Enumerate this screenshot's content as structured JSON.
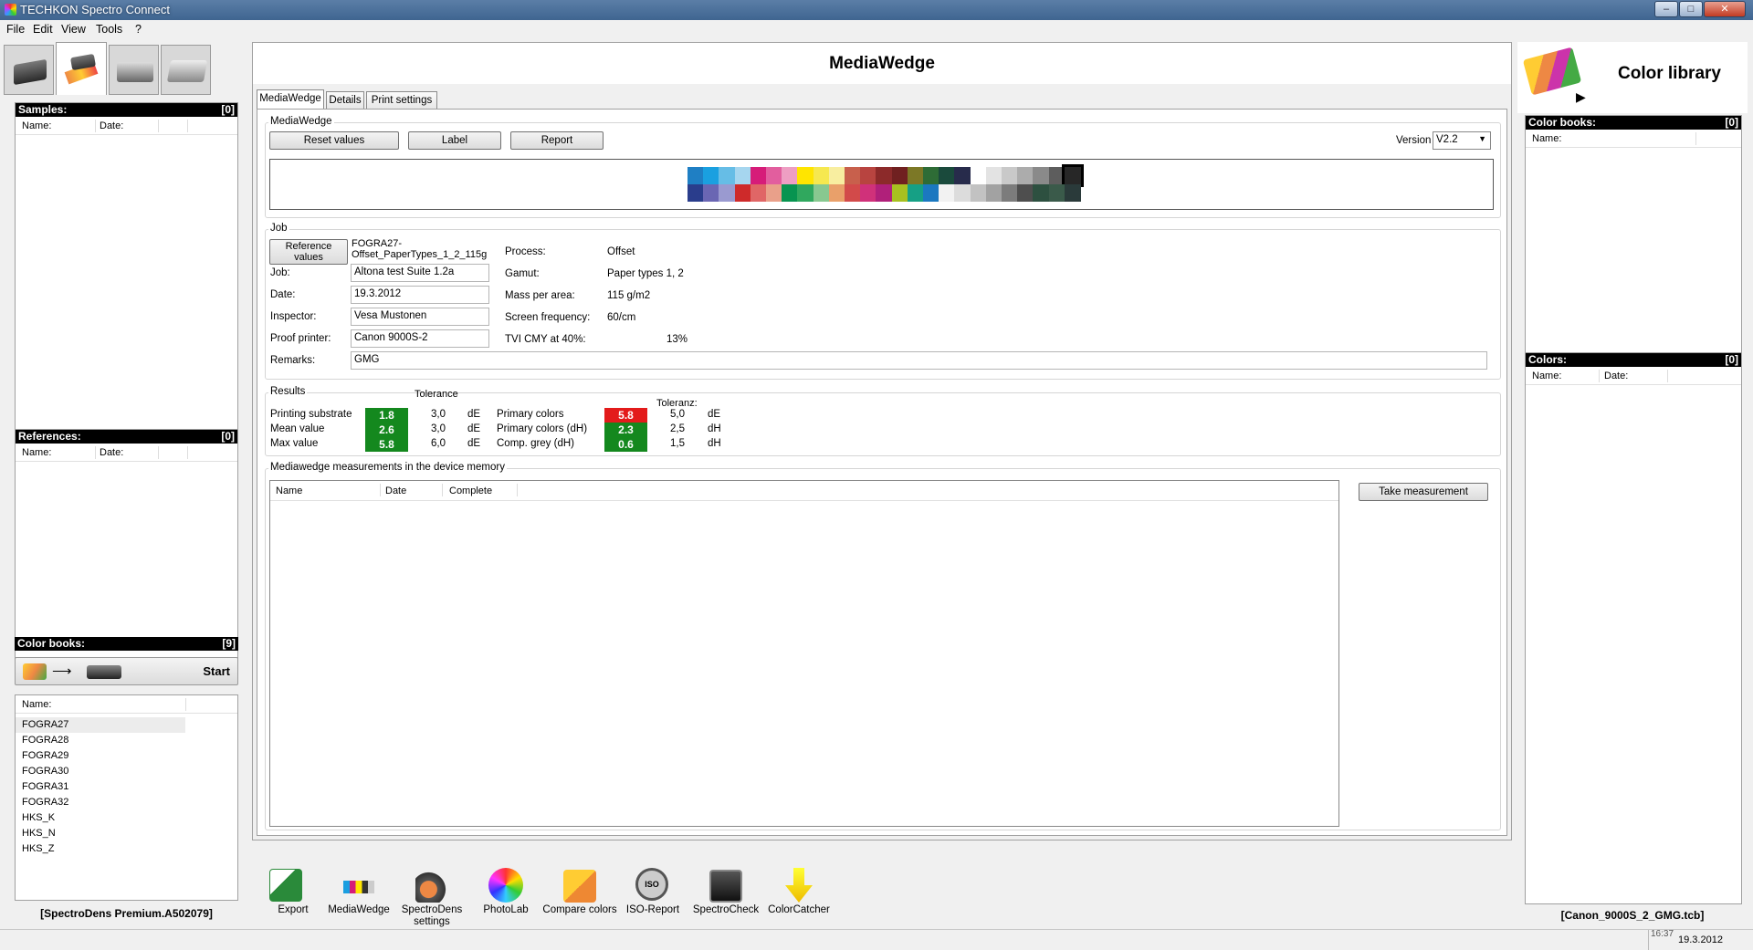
{
  "window": {
    "title": "TECHKON Spectro Connect"
  },
  "menu": [
    "File",
    "Edit",
    "View",
    "Tools",
    "?"
  ],
  "left": {
    "samples": {
      "title": "Samples:",
      "count": "[0]",
      "col_name": "Name:",
      "col_date": "Date:"
    },
    "references": {
      "title": "References:",
      "count": "[0]",
      "col_name": "Name:",
      "col_date": "Date:"
    },
    "colorbooks": {
      "title": "Color books:",
      "count": "[9]",
      "start": "Start",
      "col_name": "Name:",
      "items": [
        "FOGRA27",
        "FOGRA28",
        "FOGRA29",
        "FOGRA30",
        "FOGRA31",
        "FOGRA32",
        "HKS_K",
        "HKS_N",
        "HKS_Z"
      ]
    },
    "device": "[SpectroDens Premium.A502079]"
  },
  "center": {
    "title": "MediaWedge",
    "tabs": [
      "MediaWedge",
      "Details",
      "Print settings"
    ],
    "mediawedge_group": "MediaWedge",
    "buttons": {
      "reset": "Reset values",
      "label": "Label",
      "report": "Report"
    },
    "version_label": "Version",
    "version_value": "V2.2",
    "wedge_top": [
      "#1f7fc4",
      "#1aa0e0",
      "#66bde6",
      "#a6d6ef",
      "#d61c79",
      "#e25e9e",
      "#ee9ec3",
      "#ffe500",
      "#f6e84f",
      "#f8eea0",
      "#c8604c",
      "#b84440",
      "#8c2a2a",
      "#702020",
      "#7c7826",
      "#2e6c36",
      "#1a4a3c",
      "#272b4b",
      "#ffffff",
      "#e3e3e3",
      "#c9c9c9",
      "#acacac",
      "#8a8a8a",
      "#5d5d5d",
      "#272727"
    ],
    "wedge_bottom": [
      "#2a3d8c",
      "#6a66b3",
      "#9a9ad0",
      "#ce2a2a",
      "#e06666",
      "#e9a08a",
      "#079450",
      "#30a85e",
      "#88c890",
      "#e9a06a",
      "#d24a4a",
      "#d0317a",
      "#b0207a",
      "#a8c020",
      "#16a085",
      "#1b78c0",
      "#f2f2f2",
      "#dcdcdc",
      "#c2c2c2",
      "#a2a2a2",
      "#7c7c7c",
      "#4e4e4e",
      "#2d5040",
      "#3a5a4a",
      "#2a3a3a"
    ],
    "job": {
      "group": "Job",
      "ref_button": "Reference values",
      "ref_value": "FOGRA27-Offset_PaperTypes_1_2_115g",
      "job_label": "Job:",
      "job_value": "Altona test Suite 1.2a",
      "date_label": "Date:",
      "date_value": "19.3.2012",
      "inspector_label": "Inspector:",
      "inspector_value": "Vesa Mustonen",
      "proof_label": "Proof printer:",
      "proof_value": "Canon 9000S-2",
      "remarks_label": "Remarks:",
      "remarks_value": "GMG",
      "process_label": "Process:",
      "process_value": "Offset",
      "gamut_label": "Gamut:",
      "gamut_value": "Paper types 1, 2",
      "mass_label": "Mass per area:",
      "mass_value": "115 g/m2",
      "freq_label": "Screen frequency:",
      "freq_value": "60/cm",
      "tvi_label": "TVI CMY at 40%:",
      "tvi_value": "13%"
    },
    "results": {
      "group": "Results",
      "tol_header": "Tolerance",
      "tol_header2": "Toleranz:",
      "left": [
        {
          "label": "Printing substrate",
          "value": "1.8",
          "color": "#14881e",
          "tol": "3,0",
          "unit": "dE"
        },
        {
          "label": "Mean value",
          "value": "2.6",
          "color": "#14881e",
          "tol": "3,0",
          "unit": "dE"
        },
        {
          "label": "Max value",
          "value": "5.8",
          "color": "#14881e",
          "tol": "6,0",
          "unit": "dE"
        }
      ],
      "right": [
        {
          "label": "Primary colors",
          "value": "5.8",
          "color": "#e31b1b",
          "tol": "5,0",
          "unit": "dE"
        },
        {
          "label": "Primary colors (dH)",
          "value": "2.3",
          "color": "#14881e",
          "tol": "2,5",
          "unit": "dH"
        },
        {
          "label": "Comp. grey (dH)",
          "value": "0.6",
          "color": "#14881e",
          "tol": "1,5",
          "unit": "dH"
        }
      ]
    },
    "memory": {
      "group": "Mediawedge measurements in the device memory",
      "cols": [
        "Name",
        "Date",
        "Complete"
      ],
      "take": "Take measurement"
    }
  },
  "tools": [
    {
      "icon": "export-icon",
      "label": "Export"
    },
    {
      "icon": "mediawedge-icon",
      "label": "MediaWedge"
    },
    {
      "icon": "spectrodens-settings-icon",
      "label": "SpectroDens settings"
    },
    {
      "icon": "photolab-icon",
      "label": "PhotoLab"
    },
    {
      "icon": "compare-colors-icon",
      "label": "Compare colors"
    },
    {
      "icon": "iso-report-icon",
      "label": "ISO-Report"
    },
    {
      "icon": "spectrocheck-icon",
      "label": "SpectroCheck"
    },
    {
      "icon": "colorcatcher-icon",
      "label": "ColorCatcher"
    }
  ],
  "right": {
    "title": "Color library",
    "colorbooks": {
      "title": "Color books:",
      "count": "[0]",
      "col_name": "Name:"
    },
    "colors": {
      "title": "Colors:",
      "count": "[0]",
      "col_name": "Name:",
      "col_date": "Date:"
    },
    "file": "[Canon_9000S_2_GMG.tcb]"
  },
  "status": {
    "time": "16:37",
    "date": "19.3.2012"
  }
}
